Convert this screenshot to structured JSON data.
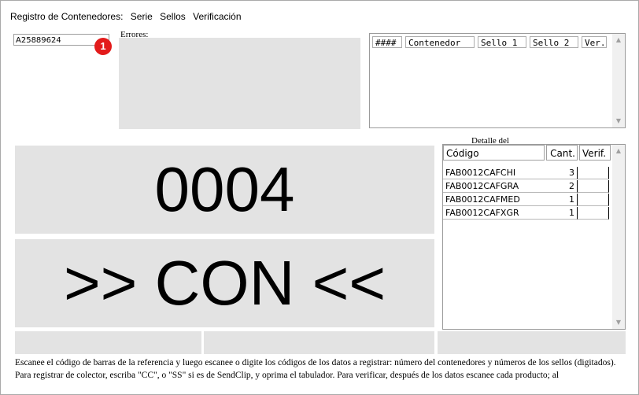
{
  "menu": [
    "Registro de Contenedores:",
    "Serie",
    "Sellos",
    "Verificación"
  ],
  "scan_input": {
    "value": "A25889624"
  },
  "badge": "1",
  "errors": {
    "label": "Errores:"
  },
  "containers": {
    "headers": [
      "####",
      "Contenedor",
      "Sello 1",
      "Sello 2",
      "Ver."
    ]
  },
  "display": {
    "number": "0004",
    "mode": ">> CON <<"
  },
  "detail": {
    "label": "Detalle del",
    "headers": [
      "Código",
      "Cant.",
      "Verif."
    ],
    "rows": [
      {
        "code": "FAB0012CAFCHI",
        "qty": "3",
        "verif": ""
      },
      {
        "code": "FAB0012CAFGRA",
        "qty": "2",
        "verif": ""
      },
      {
        "code": "FAB0012CAFMED",
        "qty": "1",
        "verif": ""
      },
      {
        "code": "FAB0012CAFXGR",
        "qty": "1",
        "verif": ""
      }
    ]
  },
  "help_text": "Escanee el código de barras de la referencia y luego escanee o digite los códigos de los datos a registrar: número del contenedores y números de los sellos (digitados). Para registrar de colector, escriba \"CC\", o \"SS\" si es de SendClip, y oprima el tabulador. Para verificar, después de los datos escanee cada producto; al"
}
